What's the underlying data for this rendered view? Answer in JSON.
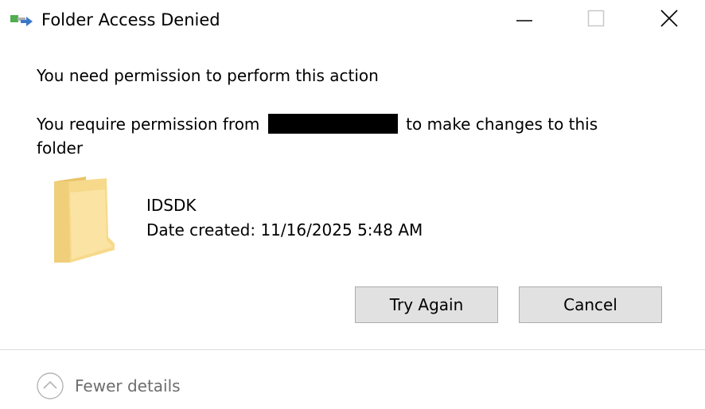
{
  "window": {
    "title": "Folder Access Denied",
    "controls": [
      "minimize-icon",
      "maximize-icon",
      "close-icon"
    ]
  },
  "content": {
    "heading": "You need permission to perform this action",
    "message_prefix": "You require permission from",
    "message_suffix": "to make changes to this",
    "message_line2": "folder",
    "item": {
      "name": "IDSDK",
      "date_created": "Date created: 11/16/2025 5:48 AM",
      "icon": "folder-icon"
    }
  },
  "buttons": {
    "try_again": "Try Again",
    "cancel": "Cancel"
  },
  "footer": {
    "details_toggle": "Fewer details",
    "icon": "chevron-up-icon"
  },
  "colors": {
    "button_bg": "#e1e1e1",
    "button_border": "#adadad",
    "muted_text": "#6d6d6d",
    "folder": "#f7d98b"
  }
}
